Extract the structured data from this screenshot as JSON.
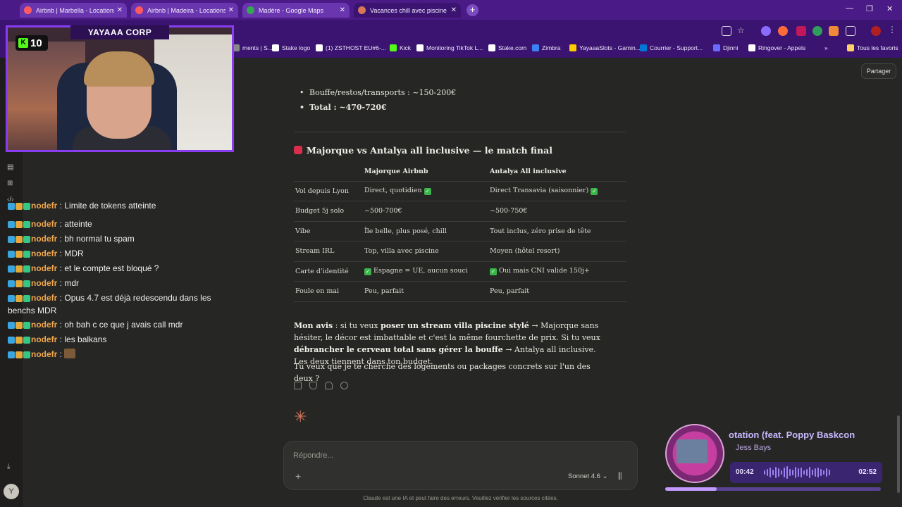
{
  "tabs": [
    {
      "label": "Airbnb | Marbella - Locations de",
      "color": "#ff5a5f"
    },
    {
      "label": "Airbnb | Madeira - Locations de",
      "color": "#ff5a5f"
    },
    {
      "label": "Madère - Google Maps",
      "color": "#34a853"
    },
    {
      "label": "Vacances chill avec piscine et m",
      "color": "#d97757"
    }
  ],
  "bookmarks": [
    {
      "label": "ments | S...",
      "color": "#888"
    },
    {
      "label": "Stake logo",
      "color": "#ffffff"
    },
    {
      "label": "(1) ZSTHOST EU#6-...",
      "color": "#ffffff"
    },
    {
      "label": "Kick",
      "color": "#53fc18"
    },
    {
      "label": "Monitoring TikTok L...",
      "color": "#ffffff"
    },
    {
      "label": "Stake.com",
      "color": "#ffffff"
    },
    {
      "label": "Zimbra",
      "color": "#3b82f6"
    },
    {
      "label": "YayaaaSlots - Gamin...",
      "color": "#ffcc00"
    },
    {
      "label": "Courrier - Support...",
      "color": "#0078d4"
    },
    {
      "label": "Djinni",
      "color": "#6b6bff"
    },
    {
      "label": "Ringover - Appels",
      "color": "#ffffff"
    },
    {
      "label": "Tous les favoris",
      "color": "#ffd166"
    }
  ],
  "overlay": {
    "cam_title": "YAYAAA CORP",
    "kick_icon": "K",
    "kick_count": "10"
  },
  "chat": [
    {
      "user": "nodefr",
      "sep": " : ",
      "msg": "Limite de tokens atteinte",
      "emote": false
    },
    {
      "user": "nodefr",
      "sep": " : ",
      "msg": "atteinte",
      "emote": false
    },
    {
      "user": "nodefr",
      "sep": " : ",
      "msg": "bh normal tu spam",
      "emote": false
    },
    {
      "user": "nodefr",
      "sep": " : ",
      "msg": "MDR",
      "emote": false
    },
    {
      "user": "nodefr",
      "sep": " : ",
      "msg": "et le compte est bloqué ?",
      "emote": false
    },
    {
      "user": "nodefr",
      "sep": " : ",
      "msg": "mdr",
      "emote": false
    },
    {
      "user": "nodefr",
      "sep": " : ",
      "msg": "Opus 4.7 est déjà redescendu dans les benchs MDR",
      "emote": false
    },
    {
      "user": "nodefr",
      "sep": " : ",
      "msg": "oh bah c ce que j avais call mdr",
      "emote": false
    },
    {
      "user": "nodefr",
      "sep": " : ",
      "msg": "les balkans",
      "emote": false
    },
    {
      "user": "nodefr",
      "sep": " : ",
      "msg": "",
      "emote": true
    }
  ],
  "header": {
    "share_label": "Partager"
  },
  "content": {
    "bullets": [
      {
        "text": "Bouffe/restos/transports : ~150-200€",
        "bold": false
      },
      {
        "text": "Total : ~470-720€",
        "bold": true
      }
    ],
    "heading": "Majorque vs Antalya all inclusive — le match final",
    "table": {
      "headers": [
        "",
        "Majorque Airbnb",
        "Antalya All inclusive"
      ],
      "rows": [
        {
          "label": "Vol depuis Lyon",
          "a": "Direct, quotidien",
          "a_check": "end",
          "b": "Direct Transavia (saisonnier)",
          "b_check": "end"
        },
        {
          "label": "Budget 5j solo",
          "a": "~500-700€",
          "a_check": "",
          "b": "~500-750€",
          "b_check": ""
        },
        {
          "label": "Vibe",
          "a": "Île belle, plus posé, chill",
          "a_check": "",
          "b": "Tout inclus, zéro prise de tête",
          "b_check": ""
        },
        {
          "label": "Stream IRL",
          "a": "Top, villa avec piscine",
          "a_check": "",
          "b": "Moyen (hôtel resort)",
          "b_check": ""
        },
        {
          "label": "Carte d'identité",
          "a": "Espagne = UE, aucun souci",
          "a_check": "start",
          "b": "Oui mais CNI valide 150j+",
          "b_check": "start"
        },
        {
          "label": "Foule en mai",
          "a": "Peu, parfait",
          "a_check": "",
          "b": "Peu, parfait",
          "b_check": ""
        }
      ]
    },
    "opinion": {
      "p1_bold": "Mon avis",
      "p1_a": " : si tu veux ",
      "p1_b_bold": "poser un stream villa piscine stylé",
      "p1_c": " → Majorque sans hésiter, le décor est imbattable et c'est la même fourchette de prix. Si tu veux ",
      "p1_d_bold": "débrancher le cerveau total sans gérer la bouffe",
      "p1_e": " → Antalya all inclusive. Les deux tiennent dans ton budget.",
      "p2": "Tu veux que je te cherche des logements ou packages concrets sur l'un des deux ?"
    }
  },
  "composer": {
    "placeholder": "Répondre...",
    "model": "Sonnet 4.6 ⌄",
    "disclaimer": "Claude est une IA et peut faire des erreurs. Veuillez vérifier les sources citées."
  },
  "music": {
    "title": "otation (feat. Poppy Baskcon",
    "artist": "Jess Bays",
    "elapsed": "00:42",
    "duration": "02:52",
    "progress": 0.24
  },
  "user_avatar": "Y"
}
